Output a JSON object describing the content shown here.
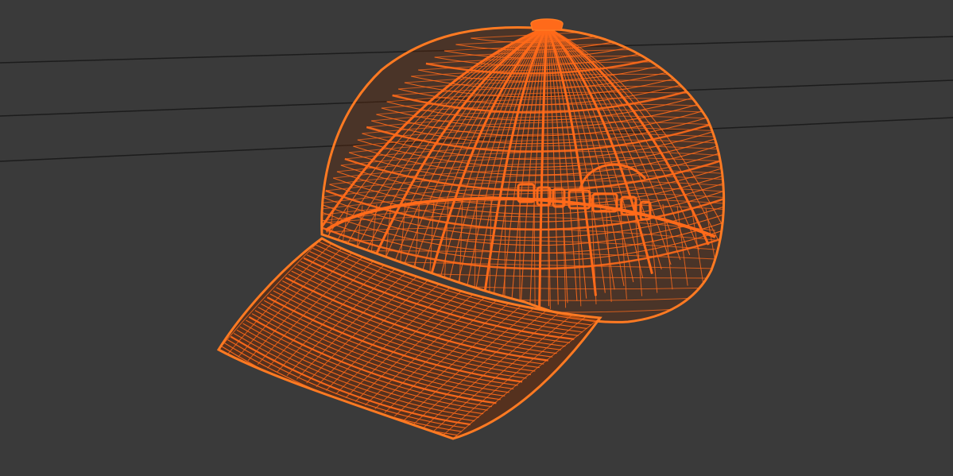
{
  "viewport": {
    "background_color": "#3a3a3a",
    "grid_line_color": "#1c1c1c"
  },
  "model": {
    "object": "baseball-cap",
    "display_mode": "wireframe",
    "selected": true,
    "wire_color": "#ff6a1a",
    "outline_color": "#ff7a22",
    "dark_fill_color": "#6b2a08"
  }
}
